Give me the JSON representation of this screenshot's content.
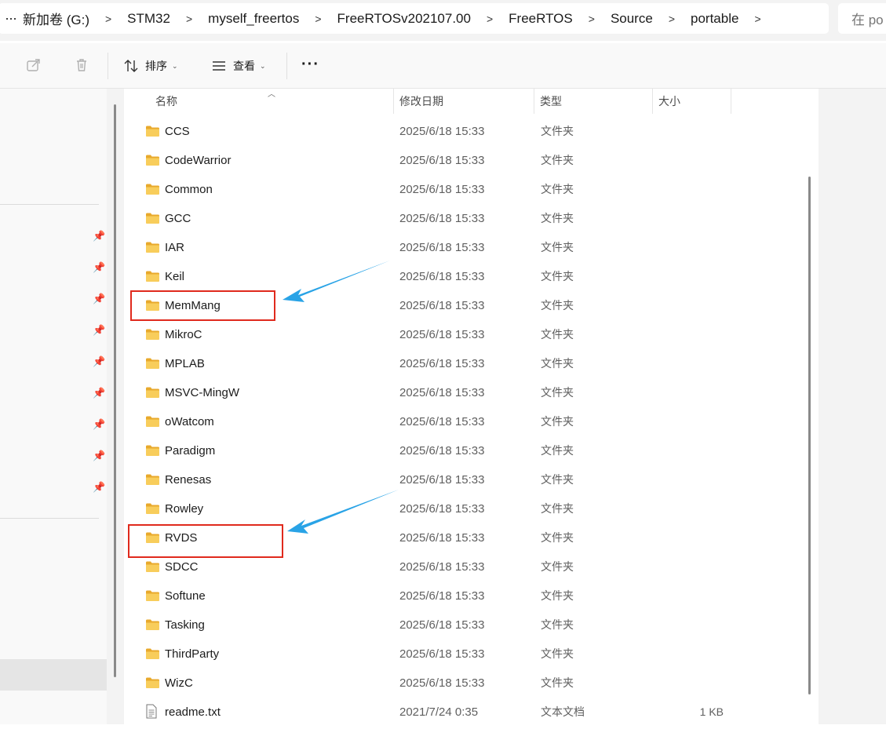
{
  "address_bar": {
    "more": "···",
    "crumbs": [
      "新加卷 (G:)",
      "STM32",
      "myself_freertos",
      "FreeRTOSv202107.00",
      "FreeRTOS",
      "Source",
      "portable"
    ],
    "separator": ">",
    "search_placeholder": "在 po"
  },
  "toolbar": {
    "sort_label": "排序",
    "view_label": "查看",
    "more_label": "···"
  },
  "columns": {
    "name": "名称",
    "modified": "修改日期",
    "type": "类型",
    "size": "大小"
  },
  "files": [
    {
      "name": "CCS",
      "modified": "2025/6/18 15:33",
      "type": "文件夹",
      "size": "",
      "icon": "folder-icon"
    },
    {
      "name": "CodeWarrior",
      "modified": "2025/6/18 15:33",
      "type": "文件夹",
      "size": "",
      "icon": "folder-icon"
    },
    {
      "name": "Common",
      "modified": "2025/6/18 15:33",
      "type": "文件夹",
      "size": "",
      "icon": "folder-icon"
    },
    {
      "name": "GCC",
      "modified": "2025/6/18 15:33",
      "type": "文件夹",
      "size": "",
      "icon": "folder-icon"
    },
    {
      "name": "IAR",
      "modified": "2025/6/18 15:33",
      "type": "文件夹",
      "size": "",
      "icon": "folder-icon"
    },
    {
      "name": "Keil",
      "modified": "2025/6/18 15:33",
      "type": "文件夹",
      "size": "",
      "icon": "folder-icon"
    },
    {
      "name": "MemMang",
      "modified": "2025/6/18 15:33",
      "type": "文件夹",
      "size": "",
      "icon": "folder-icon"
    },
    {
      "name": "MikroC",
      "modified": "2025/6/18 15:33",
      "type": "文件夹",
      "size": "",
      "icon": "folder-icon"
    },
    {
      "name": "MPLAB",
      "modified": "2025/6/18 15:33",
      "type": "文件夹",
      "size": "",
      "icon": "folder-icon"
    },
    {
      "name": "MSVC-MingW",
      "modified": "2025/6/18 15:33",
      "type": "文件夹",
      "size": "",
      "icon": "folder-icon"
    },
    {
      "name": "oWatcom",
      "modified": "2025/6/18 15:33",
      "type": "文件夹",
      "size": "",
      "icon": "folder-icon"
    },
    {
      "name": "Paradigm",
      "modified": "2025/6/18 15:33",
      "type": "文件夹",
      "size": "",
      "icon": "folder-icon"
    },
    {
      "name": "Renesas",
      "modified": "2025/6/18 15:33",
      "type": "文件夹",
      "size": "",
      "icon": "folder-icon"
    },
    {
      "name": "Rowley",
      "modified": "2025/6/18 15:33",
      "type": "文件夹",
      "size": "",
      "icon": "folder-icon"
    },
    {
      "name": "RVDS",
      "modified": "2025/6/18 15:33",
      "type": "文件夹",
      "size": "",
      "icon": "folder-icon"
    },
    {
      "name": "SDCC",
      "modified": "2025/6/18 15:33",
      "type": "文件夹",
      "size": "",
      "icon": "folder-icon"
    },
    {
      "name": "Softune",
      "modified": "2025/6/18 15:33",
      "type": "文件夹",
      "size": "",
      "icon": "folder-icon"
    },
    {
      "name": "Tasking",
      "modified": "2025/6/18 15:33",
      "type": "文件夹",
      "size": "",
      "icon": "folder-icon"
    },
    {
      "name": "ThirdParty",
      "modified": "2025/6/18 15:33",
      "type": "文件夹",
      "size": "",
      "icon": "folder-icon"
    },
    {
      "name": "WizC",
      "modified": "2025/6/18 15:33",
      "type": "文件夹",
      "size": "",
      "icon": "folder-icon"
    },
    {
      "name": "readme.txt",
      "modified": "2021/7/24 0:35",
      "type": "文本文档",
      "size": "1 KB",
      "icon": "text-file-icon"
    }
  ],
  "highlighted": [
    "MemMang",
    "RVDS"
  ],
  "colors": {
    "highlight_box": "#e02a1d",
    "arrow": "#29a3e6",
    "folder": "#f5c244"
  }
}
